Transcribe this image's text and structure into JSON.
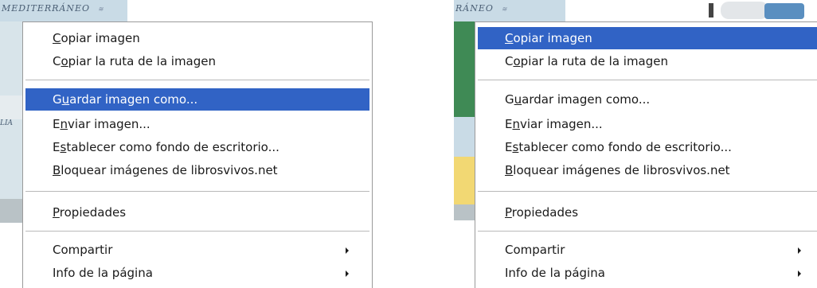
{
  "left_panel": {
    "map_label": "MEDITERRÁNEO",
    "map_mark": "≋",
    "side_label": "LIA",
    "menu": {
      "copy_image": {
        "pre": "",
        "u": "C",
        "post": "opiar imagen"
      },
      "copy_image_path": {
        "pre": "C",
        "u": "o",
        "post": "piar la ruta de la imagen"
      },
      "save_image_as": {
        "pre": "G",
        "u": "u",
        "post": "ardar imagen como..."
      },
      "send_image": {
        "pre": "E",
        "u": "n",
        "post": "viar imagen..."
      },
      "set_as_wallpaper": {
        "pre": "E",
        "u": "s",
        "post": "tablecer como fondo de escritorio..."
      },
      "block_images": {
        "pre": "",
        "u": "B",
        "post": "loquear imágenes de librosvivos.net"
      },
      "properties": {
        "pre": "",
        "u": "P",
        "post": "ropiedades"
      },
      "share": "Compartir",
      "page_info": "Info de la página"
    }
  },
  "right_panel": {
    "map_label": "RÁNEO",
    "map_mark": "≋",
    "menu": {
      "copy_image": {
        "pre": "",
        "u": "C",
        "post": "opiar imagen"
      },
      "copy_image_path": {
        "pre": "C",
        "u": "o",
        "post": "piar la ruta de la imagen"
      },
      "save_image_as": {
        "pre": "G",
        "u": "u",
        "post": "ardar imagen como..."
      },
      "send_image": {
        "pre": "E",
        "u": "n",
        "post": "viar imagen..."
      },
      "set_as_wallpaper": {
        "pre": "E",
        "u": "s",
        "post": "tablecer como fondo de escritorio..."
      },
      "block_images": {
        "pre": "",
        "u": "B",
        "post": "loquear imágenes de librosvivos.net"
      },
      "properties": {
        "pre": "",
        "u": "P",
        "post": "ropiedades"
      },
      "share": "Compartir",
      "page_info": "Info de la página"
    }
  },
  "colors": {
    "highlight": "#3163c5",
    "map_water": "#c9dbe6",
    "map_land": "#3f8a55"
  },
  "icons": [
    "submenu-arrow-icon"
  ]
}
